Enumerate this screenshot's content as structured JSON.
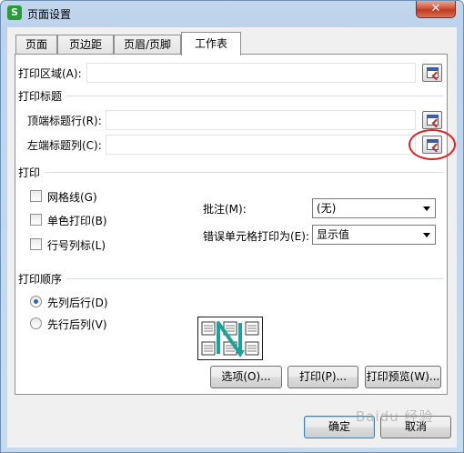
{
  "window": {
    "title": "页面设置",
    "close_symbol": "✕"
  },
  "tabs": [
    {
      "label": "页面",
      "active": false
    },
    {
      "label": "页边距",
      "active": false
    },
    {
      "label": "页眉/页脚",
      "active": false
    },
    {
      "label": "工作表",
      "active": true
    }
  ],
  "print_area": {
    "label": "打印区域(A):",
    "value": ""
  },
  "print_titles": {
    "group_label": "打印标题",
    "top_rows": {
      "label": "顶端标题行(R):",
      "value": ""
    },
    "left_columns": {
      "label": "左端标题列(C):",
      "value": ""
    }
  },
  "print": {
    "group_label": "打印",
    "gridlines": {
      "label": "网格线(G)",
      "checked": false
    },
    "black_white": {
      "label": "单色打印(B)",
      "checked": false
    },
    "row_col_headings": {
      "label": "行号列标(L)",
      "checked": false
    },
    "comments": {
      "label": "批注(M):",
      "value": "(无)"
    },
    "cell_errors": {
      "label": "错误单元格打印为(E):",
      "value": "显示值"
    }
  },
  "page_order": {
    "group_label": "打印顺序",
    "down_then_over": {
      "label": "先列后行(D)",
      "checked": true
    },
    "over_then_down": {
      "label": "先行后列(V)",
      "checked": false
    }
  },
  "buttons": {
    "options": "选项(O)...",
    "print": "打印(P)...",
    "print_preview": "打印预览(W)...",
    "ok": "确定",
    "cancel": "取消"
  },
  "watermark": "Baidu 经验",
  "colors": {
    "accent": "#2f64b3",
    "highlight_ring": "#e32222",
    "arrow": "#1aa39a"
  }
}
